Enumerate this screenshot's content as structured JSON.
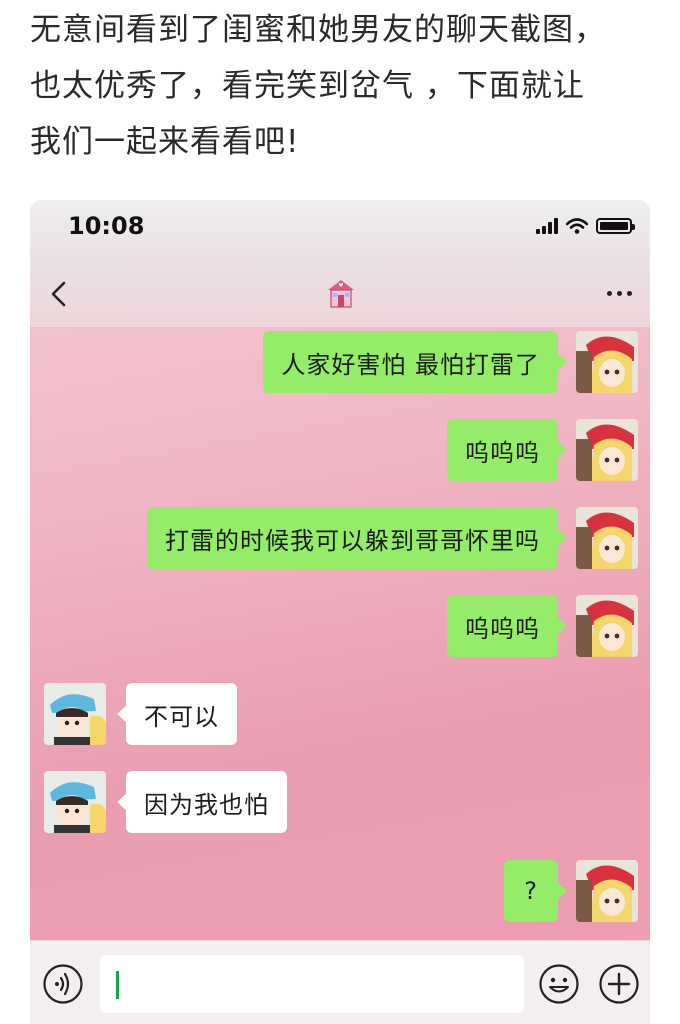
{
  "article": {
    "lines": [
      "无意间看到了闺蜜和她男友的聊天截图，",
      "也太优秀了，看完笑到岔气 ，下面就让",
      "我们一起来看看吧!"
    ]
  },
  "status_bar": {
    "time": "10:08",
    "icons": [
      "signal-icon",
      "wifi-icon",
      "battery-icon"
    ]
  },
  "nav": {
    "icons": [
      "back-chevron-icon",
      "house-emoji-icon",
      "more-dots-icon"
    ]
  },
  "messages": [
    {
      "side": "out",
      "text": "人家好害怕 最怕打雷了"
    },
    {
      "side": "out",
      "text": "呜呜呜"
    },
    {
      "side": "out",
      "text": "打雷的时候我可以躲到哥哥怀里吗"
    },
    {
      "side": "out",
      "text": "呜呜呜"
    },
    {
      "side": "in",
      "text": "不可以"
    },
    {
      "side": "in",
      "text": "因为我也怕"
    },
    {
      "side": "out",
      "text": "?"
    }
  ],
  "input_bar": {
    "icons": [
      "voice-icon",
      "emoji-icon",
      "plus-icon"
    ],
    "value": ""
  },
  "colors": {
    "sent_bubble": "#95ec69",
    "received_bubble": "#ffffff",
    "chat_background": "#ea9db1"
  }
}
